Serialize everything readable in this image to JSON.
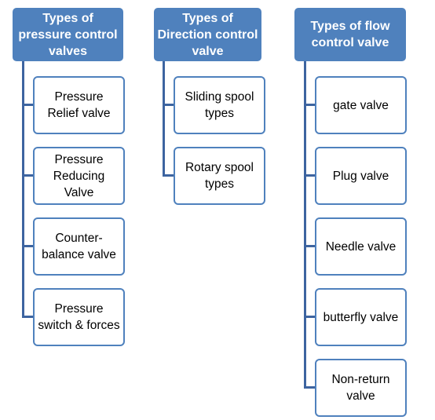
{
  "colors": {
    "header": "#4f81bd",
    "connector": "#3d64a0"
  },
  "columns": [
    {
      "title": "Types of pressure control valves",
      "items": [
        "Pressure Relief valve",
        "Pressure Reducing Valve",
        "Counter-balance valve",
        "Pressure switch & forces"
      ]
    },
    {
      "title": "Types of Direction control valve",
      "items": [
        "Sliding spool types",
        "Rotary spool types"
      ]
    },
    {
      "title": "Types of flow control valve",
      "items": [
        "gate valve",
        "Plug valve",
        "Needle valve",
        "butterfly valve",
        "Non-return valve"
      ]
    }
  ]
}
